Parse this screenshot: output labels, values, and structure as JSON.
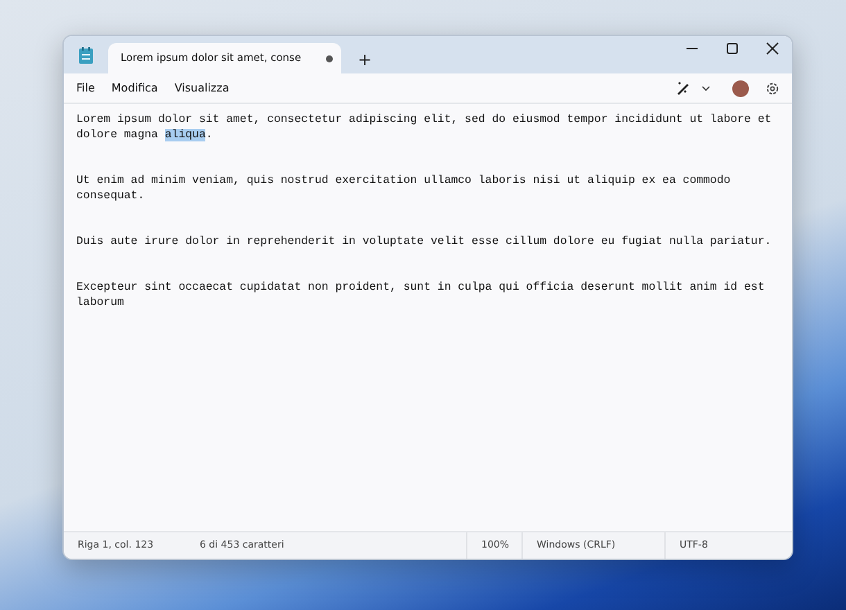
{
  "tabs": [
    {
      "label": "Lorem ipsum dolor sit amet, conse",
      "selected": true,
      "unsaved": true
    }
  ],
  "new_tab": "+",
  "menu": [
    "File",
    "Modifica",
    "Visualizza"
  ],
  "paragraphs": [
    {
      "segments": [
        {
          "text": "Lorem ipsum dolor sit amet, consectetur adipiscing elit, sed do eiusmod tempor incididunt ut labore et dolore magna ",
          "selected": false
        },
        {
          "text": "aliqua",
          "selected": true
        },
        {
          "text": ".",
          "selected": false
        }
      ]
    },
    {
      "segments": [
        {
          "text": "Ut enim ad minim veniam, quis nostrud exercitation ullamco laboris nisi ut aliquip ex ea commodo consequat.",
          "selected": false
        }
      ]
    },
    {
      "segments": [
        {
          "text": "Duis aute irure dolor in reprehenderit in voluptate velit esse cillum dolore eu fugiat nulla pariatur.",
          "selected": false
        }
      ]
    },
    {
      "segments": [
        {
          "text": "Excepteur sint occaecat cupidatat non proident, sunt in culpa qui officia deserunt mollit anim id est laborum",
          "selected": false
        }
      ]
    }
  ],
  "status_bar": {
    "position": "Riga 1, col. 123",
    "selection": "6 di 453 caratteri",
    "zoom": "100%",
    "line_ending": "Windows (CRLF)",
    "encoding": "UTF-8"
  }
}
